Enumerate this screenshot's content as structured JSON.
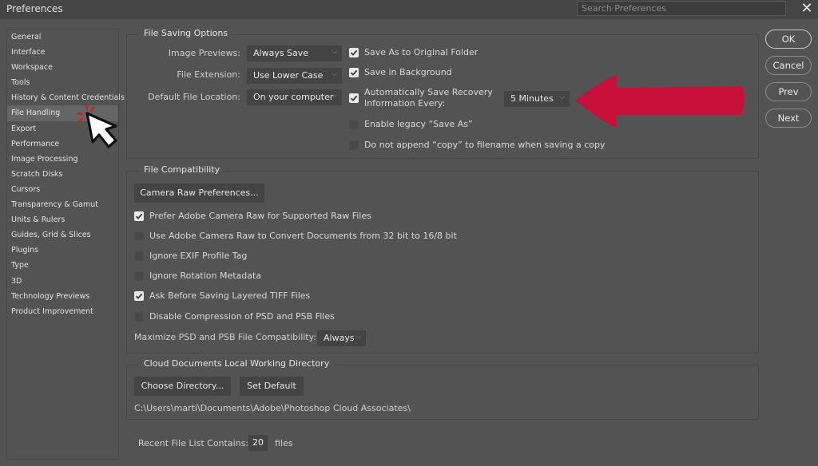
{
  "window": {
    "title": "Preferences",
    "search_placeholder": "Search Preferences",
    "close_icon": "close-icon"
  },
  "sidebar": {
    "items": [
      {
        "label": "General",
        "active": false
      },
      {
        "label": "Interface",
        "active": false
      },
      {
        "label": "Workspace",
        "active": false
      },
      {
        "label": "Tools",
        "active": false
      },
      {
        "label": "History & Content Credentials",
        "active": false
      },
      {
        "label": "File Handling",
        "active": true
      },
      {
        "label": "Export",
        "active": false
      },
      {
        "label": "Performance",
        "active": false
      },
      {
        "label": "Image Processing",
        "active": false
      },
      {
        "label": "Scratch Disks",
        "active": false
      },
      {
        "label": "Cursors",
        "active": false
      },
      {
        "label": "Transparency & Gamut",
        "active": false
      },
      {
        "label": "Units & Rulers",
        "active": false
      },
      {
        "label": "Guides, Grid & Slices",
        "active": false
      },
      {
        "label": "Plugins",
        "active": false
      },
      {
        "label": "Type",
        "active": false
      },
      {
        "label": "3D",
        "active": false
      },
      {
        "label": "Technology Previews",
        "active": false
      },
      {
        "label": "Product Improvement",
        "active": false
      }
    ]
  },
  "file_saving": {
    "title": "File Saving Options",
    "image_previews_label": "Image Previews:",
    "image_previews_value": "Always Save",
    "file_extension_label": "File Extension:",
    "file_extension_value": "Use Lower Case",
    "default_location_label": "Default File Location:",
    "default_location_value": "On your computer",
    "checkboxes": [
      {
        "label": "Save As to Original Folder",
        "checked": true
      },
      {
        "label": "Save in Background",
        "checked": true
      },
      {
        "label_line1": "Automatically Save Recovery",
        "label_line2": "Information Every:",
        "checked": true
      },
      {
        "label": "Enable legacy “Save As”",
        "checked": false
      },
      {
        "label": "Do not append “copy” to filename when saving a copy",
        "checked": false
      }
    ],
    "recovery_interval_value": "5 Minutes"
  },
  "file_compat": {
    "title": "File Compatibility",
    "camera_raw_button": "Camera Raw Preferences...",
    "checkboxes": [
      {
        "label": "Prefer Adobe Camera Raw for Supported Raw Files",
        "checked": true
      },
      {
        "label": "Use Adobe Camera Raw to Convert Documents from 32 bit to 16/8 bit",
        "checked": false
      },
      {
        "label": "Ignore EXIF Profile Tag",
        "checked": false
      },
      {
        "label": "Ignore Rotation Metadata",
        "checked": false
      },
      {
        "label": "Ask Before Saving Layered TIFF Files",
        "checked": true
      },
      {
        "label": "Disable Compression of PSD and PSB Files",
        "checked": false
      }
    ],
    "maximize_label": "Maximize PSD and PSB File Compatibility:",
    "maximize_value": "Always"
  },
  "cloud": {
    "title": "Cloud Documents Local Working Directory",
    "choose_button": "Choose Directory...",
    "default_button": "Set Default",
    "path": "C:\\Users\\marti\\Documents\\Adobe\\Photoshop Cloud Associates\\"
  },
  "recent": {
    "label": "Recent File List Contains:",
    "value": "20",
    "suffix": "files"
  },
  "actions": {
    "ok": "OK",
    "cancel": "Cancel",
    "prev": "Prev",
    "next": "Next"
  },
  "annotations": {
    "arrow_color": "#c8103a",
    "cursor_spark_color": "#e8121e"
  }
}
